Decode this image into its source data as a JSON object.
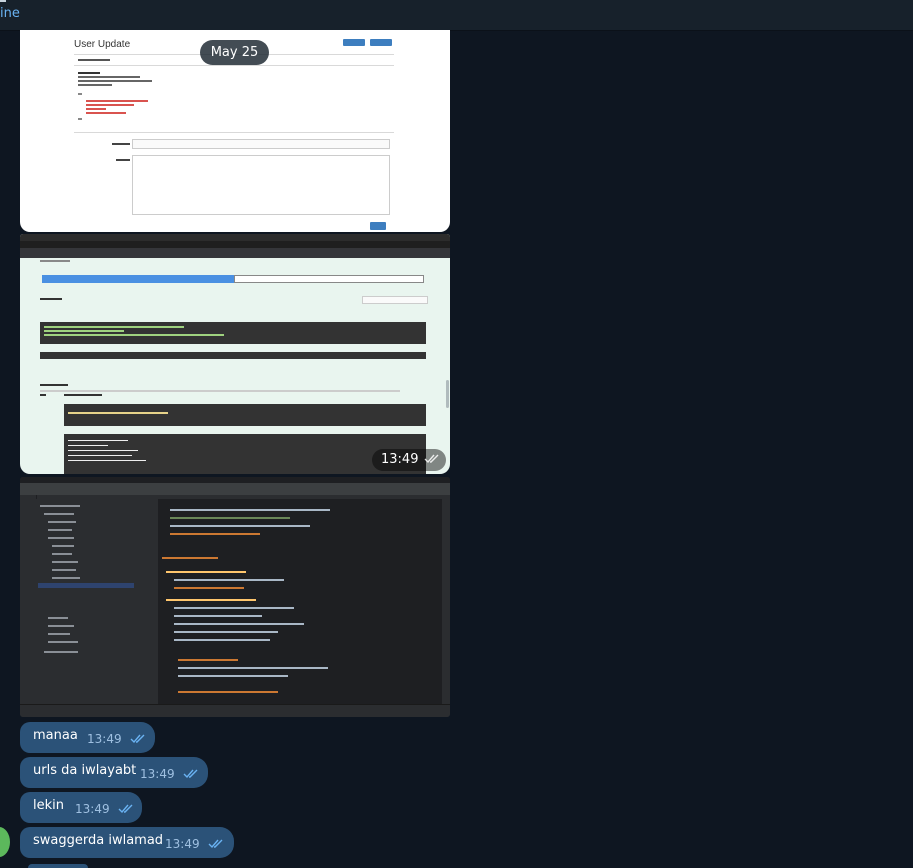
{
  "header": {
    "status": "ine"
  },
  "date_separator": "May 25",
  "media": [
    {
      "kind": "screenshot",
      "subject": "swagger-user-update",
      "title": "User Update",
      "buttons": [
        "OPTIONS",
        "GET"
      ],
      "post_label": "POST"
    },
    {
      "kind": "screenshot",
      "subject": "swagger-execute-response",
      "buttons": [
        "Execute",
        "Clear"
      ],
      "time": "13:49"
    },
    {
      "kind": "screenshot",
      "subject": "pycharm-editor"
    }
  ],
  "messages": [
    {
      "text": "manaa",
      "time": "13:49",
      "read": true
    },
    {
      "text": "urls da iwlayabt",
      "time": "13:49",
      "read": true
    },
    {
      "text": "lekin",
      "time": "13:49",
      "read": true
    },
    {
      "text": "swaggerda iwlamad",
      "time": "13:49",
      "read": true
    }
  ],
  "colors": {
    "background": "#0e1621",
    "outgoing_bubble": "#2b5278",
    "accent": "#6ab3f3",
    "check_read": "#6ab3f3"
  },
  "icons": [
    "double-check-icon"
  ]
}
